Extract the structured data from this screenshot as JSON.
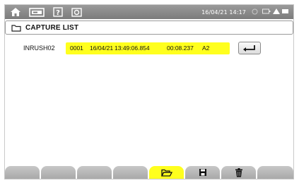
{
  "status_bar": {
    "icons": [
      "home-icon",
      "measure-mode-icon",
      "help-icon",
      "camera-icon"
    ],
    "datetime": "16/04/21 14:17",
    "status_icons": [
      "clock-icon",
      "battery-icon",
      "signal-icon"
    ]
  },
  "title_bar": {
    "icon": "folder-icon",
    "title": "CAPTURE LIST"
  },
  "capture_list": {
    "items": [
      {
        "name": "INRUSH02",
        "number": "0001",
        "date": "16/04/21",
        "time": "13:49:06.854",
        "duration": "00:08.237",
        "channel": "A2",
        "enter_icon": "enter-icon"
      }
    ]
  },
  "function_keys": [
    {
      "icon": "",
      "active": false
    },
    {
      "icon": "",
      "active": false
    },
    {
      "icon": "",
      "active": false
    },
    {
      "icon": "",
      "active": false
    },
    {
      "icon": "open-folder-icon",
      "active": true
    },
    {
      "icon": "save-icon",
      "active": false
    },
    {
      "icon": "trash-icon",
      "active": false
    },
    {
      "icon": "",
      "active": false
    }
  ],
  "colors": {
    "highlight": "#ffff1e",
    "status_bar": "#8a8a8a",
    "key": "#b8b8b8"
  }
}
